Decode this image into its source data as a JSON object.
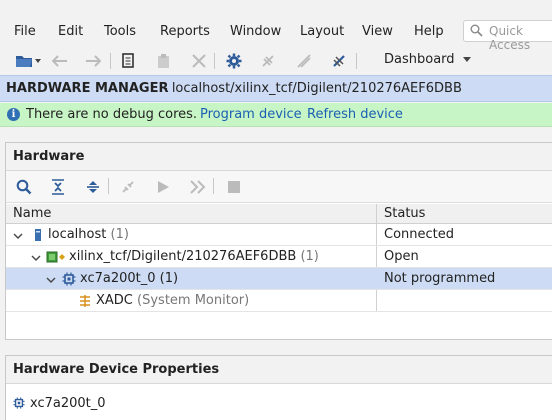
{
  "menubar": {
    "items": [
      {
        "label": "File"
      },
      {
        "label": "Edit"
      },
      {
        "label": "Tools"
      },
      {
        "label": "Reports"
      },
      {
        "label": "Window"
      },
      {
        "label": "Layout"
      },
      {
        "label": "View"
      },
      {
        "label": "Help"
      }
    ],
    "quick_access_placeholder": "Quick Access"
  },
  "toolbar": {
    "layout_label": "Dashboard"
  },
  "hardware_manager": {
    "title": "HARDWARE MANAGER",
    "path": "- localhost/xilinx_tcf/Digilent/210276AEF6DBB"
  },
  "info_bar": {
    "message": "There are no debug cores.",
    "program_link": "Program device",
    "refresh_link": "Refresh device"
  },
  "hardware_panel": {
    "title": "Hardware",
    "columns": [
      "Name",
      "Status"
    ],
    "rows": [
      {
        "name": "localhost",
        "count": "(1)",
        "status": "Connected"
      },
      {
        "name": "xilinx_tcf/Digilent/210276AEF6DBB",
        "count": "(1)",
        "status": "Open"
      },
      {
        "name": "xc7a200t_0",
        "count": "(1)",
        "status": "Not programmed"
      },
      {
        "name": "XADC",
        "count": "(System Monitor)",
        "status": ""
      }
    ]
  },
  "properties_panel": {
    "title": "Hardware Device Properties",
    "device": "xc7a200t_0"
  },
  "colors": {
    "header_blue": "#cddcf4",
    "info_green": "#c8f5c5",
    "link_blue": "#1a5fb4"
  }
}
